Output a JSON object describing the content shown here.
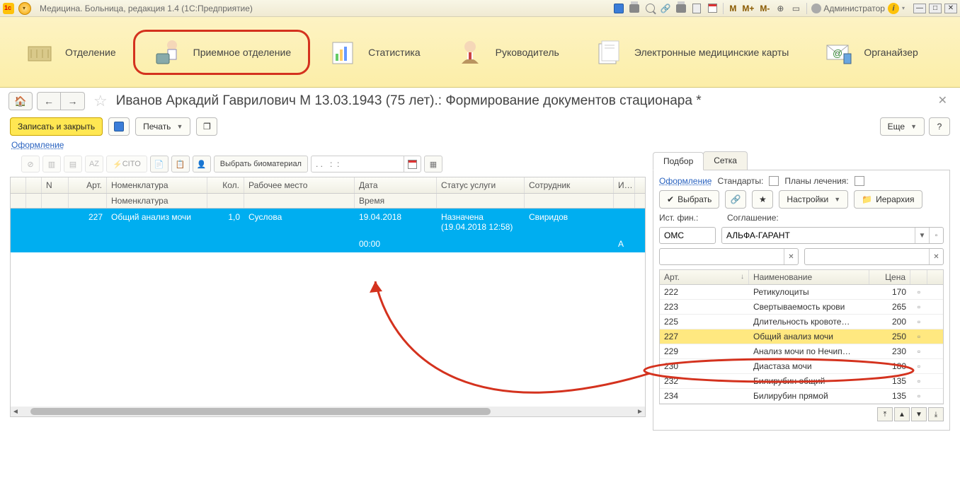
{
  "titlebar": {
    "text": "Медицина. Больница, редакция 1.4 (1С:Предприятие)",
    "m_labels": [
      "M",
      "M+",
      "M-"
    ],
    "user": "Администратор"
  },
  "sections": [
    {
      "label": "Отделение"
    },
    {
      "label": "Приемное отделение",
      "active": true
    },
    {
      "label": "Статистика"
    },
    {
      "label": "Руководитель"
    },
    {
      "label": "Электронные медицинские карты"
    },
    {
      "label": "Органайзер"
    }
  ],
  "page_title": "Иванов Аркадий Гаврилович М 13.03.1943 (75 лет).: Формирование документов стационара *",
  "toolbar": {
    "save_close": "Записать и закрыть",
    "print": "Печать",
    "more": "Еще",
    "help": "?"
  },
  "link_oform": "Оформление",
  "left_toolbar": {
    "cito": "CITO",
    "select_bio": "Выбрать биоматериал",
    "date_ph": ". .   :  :"
  },
  "left_table": {
    "headers": {
      "n": "N",
      "art": "Арт.",
      "nom": "Номенклатура",
      "kol": "Кол.",
      "rm": "Рабочее место",
      "date": "Дата",
      "stat": "Статус услуги",
      "emp": "Сотрудник",
      "fin": "И…"
    },
    "headers2": {
      "nom": "Номенклатура",
      "time": "Время"
    },
    "row": {
      "art": "227",
      "nom": "Общий анализ мочи",
      "kol": "1,0",
      "rm": "Суслова",
      "date": "19.04.2018",
      "time": "00:00",
      "stat": "Назначена",
      "stat2": "(19.04.2018 12:58)",
      "emp": "Свиридов",
      "fin": "А"
    }
  },
  "right": {
    "tabs": [
      "Подбор",
      "Сетка"
    ],
    "oform": "Оформление",
    "std": "Стандарты:",
    "plans": "Планы лечения:",
    "select": "Выбрать",
    "settings": "Настройки",
    "hier": "Иерархия",
    "ist": "Ист. фин.:",
    "sog": "Соглашение:",
    "ist_val": "ОМС",
    "sog_val": "АЛЬФА-ГАРАНТ",
    "table": {
      "headers": {
        "art": "Арт.",
        "name": "Наименование",
        "price": "Цена"
      },
      "rows": [
        {
          "art": "222",
          "name": "Ретикулоциты",
          "price": "170"
        },
        {
          "art": "223",
          "name": "Свертываемость крови",
          "price": "265"
        },
        {
          "art": "225",
          "name": "Длительность кровоте…",
          "price": "200"
        },
        {
          "art": "227",
          "name": "Общий анализ мочи",
          "price": "250",
          "selected": true
        },
        {
          "art": "229",
          "name": "Анализ мочи по Нечип…",
          "price": "230"
        },
        {
          "art": "230",
          "name": "Диастаза мочи",
          "price": "180"
        },
        {
          "art": "232",
          "name": "Билирубин общий",
          "price": "135"
        },
        {
          "art": "234",
          "name": "Билирубин прямой",
          "price": "135"
        }
      ]
    }
  }
}
